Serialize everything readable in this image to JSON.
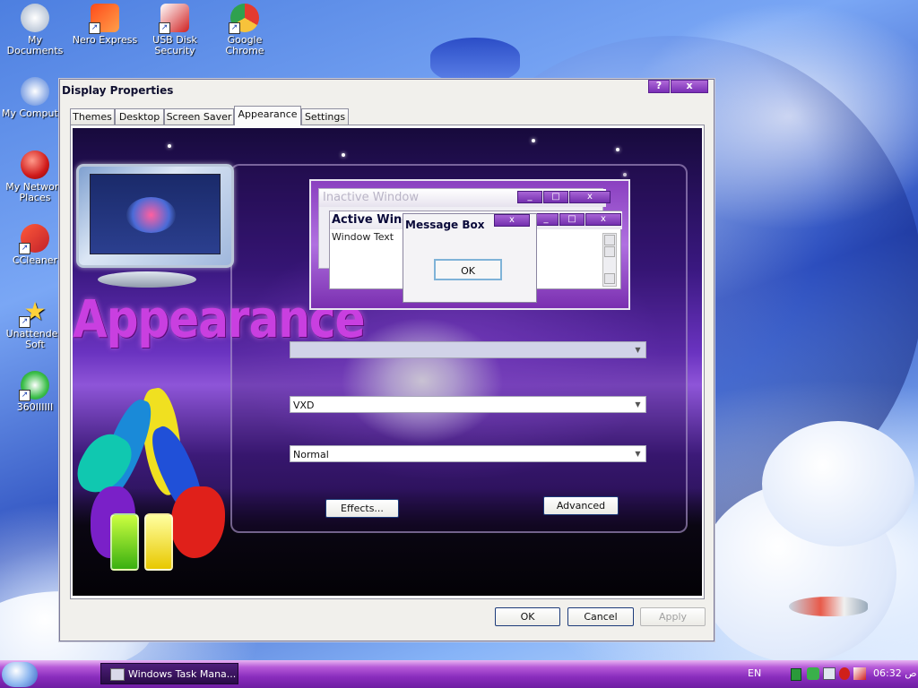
{
  "desktop": {
    "icons": [
      {
        "label": "My Documents"
      },
      {
        "label": "Nero Express"
      },
      {
        "label": "USB Disk Security"
      },
      {
        "label": "Google Chrome"
      },
      {
        "label": "My Computer"
      },
      {
        "label": "My Network Places"
      },
      {
        "label": "CCleaner"
      },
      {
        "label": "Unattended Soft"
      },
      {
        "label": "360IIIIII"
      }
    ]
  },
  "window": {
    "title": "Display Properties",
    "help_button": "?",
    "close_button": "x",
    "tabs": [
      {
        "label": "Themes"
      },
      {
        "label": "Desktop"
      },
      {
        "label": "Screen Saver"
      },
      {
        "label": "Appearance"
      },
      {
        "label": "Settings"
      }
    ],
    "active_tab": "Appearance",
    "banner_word": "Appearance",
    "preview": {
      "inactive_title": "Inactive Window",
      "active_title": "Active Windo",
      "window_text": "Window Text",
      "message_title": "Message Box",
      "message_ok": "OK",
      "min_btn": "_",
      "max_btn": "□",
      "close_btn": "x"
    },
    "combos": {
      "windows_buttons": "",
      "color_scheme": "VXD",
      "font_size": "Normal"
    },
    "effects_button": "Effects...",
    "advanced_button": "Advanced",
    "ok_button": "OK",
    "cancel_button": "Cancel",
    "apply_button": "Apply"
  },
  "taskbar": {
    "task_label": "Windows Task Mana...",
    "language": "EN",
    "clock": "06:32 ص"
  },
  "colors": {
    "accent_purple": "#8a2dbd",
    "banner_text": "#c93fe0"
  }
}
